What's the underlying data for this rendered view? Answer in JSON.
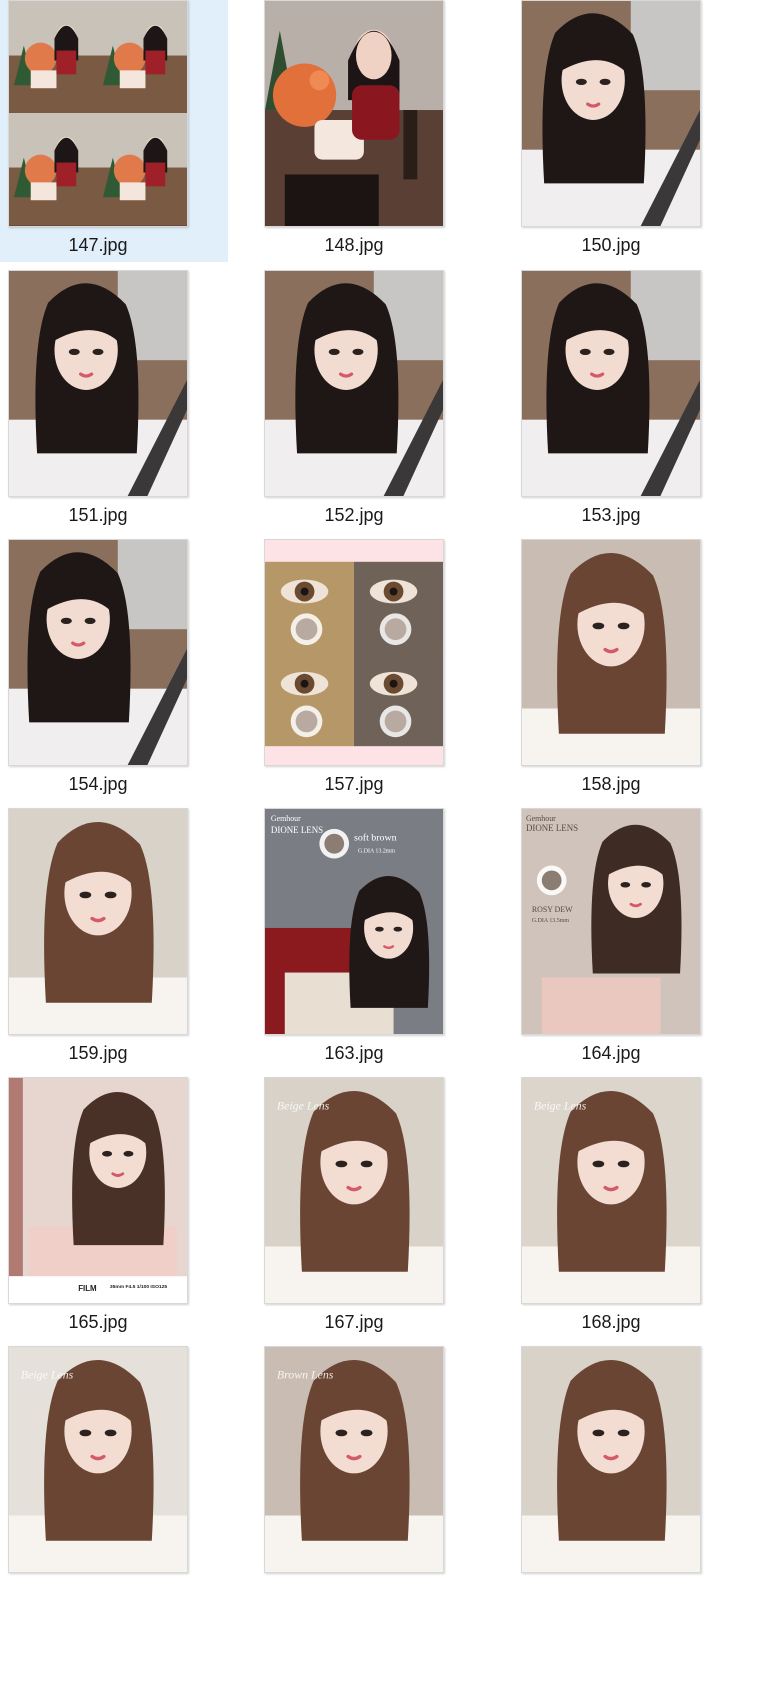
{
  "explorer": {
    "selected_index": 0,
    "files": [
      {
        "name": "147.jpg",
        "kind": "collage"
      },
      {
        "name": "148.jpg",
        "kind": "party"
      },
      {
        "name": "150.jpg",
        "kind": "car-selfie"
      },
      {
        "name": "151.jpg",
        "kind": "car-selfie"
      },
      {
        "name": "152.jpg",
        "kind": "car-selfie"
      },
      {
        "name": "153.jpg",
        "kind": "car-selfie"
      },
      {
        "name": "154.jpg",
        "kind": "car-selfie"
      },
      {
        "name": "157.jpg",
        "kind": "lens-eyes"
      },
      {
        "name": "158.jpg",
        "kind": "portrait"
      },
      {
        "name": "159.jpg",
        "kind": "portrait"
      },
      {
        "name": "163.jpg",
        "kind": "lens-ad"
      },
      {
        "name": "164.jpg",
        "kind": "lens-ad"
      },
      {
        "name": "165.jpg",
        "kind": "film-portrait"
      },
      {
        "name": "167.jpg",
        "kind": "portrait"
      },
      {
        "name": "168.jpg",
        "kind": "portrait"
      },
      {
        "name": "",
        "kind": "portrait"
      },
      {
        "name": "",
        "kind": "portrait"
      },
      {
        "name": "",
        "kind": "portrait"
      }
    ],
    "thumbnail_texts": {
      "163": {
        "brand": "Gemhour",
        "product": "DIONE LENS",
        "shade": "soft brown",
        "spec": "G.DIA 13.2mm"
      },
      "164": {
        "brand": "Gemhour",
        "product": "DIONE LENS",
        "shade": "ROSY DEW",
        "spec": "G.DIA 13.5mm"
      },
      "165": {
        "film": "FILM",
        "exif": "35mm F4.5 1/100 ISO125"
      },
      "167": {
        "watermark": "Beige Lens"
      },
      "168": {
        "watermark": "Beige Lens"
      },
      "row6_1": {
        "watermark": "Beige Lens"
      },
      "row6_2": {
        "watermark": "Brown Lens"
      }
    }
  }
}
